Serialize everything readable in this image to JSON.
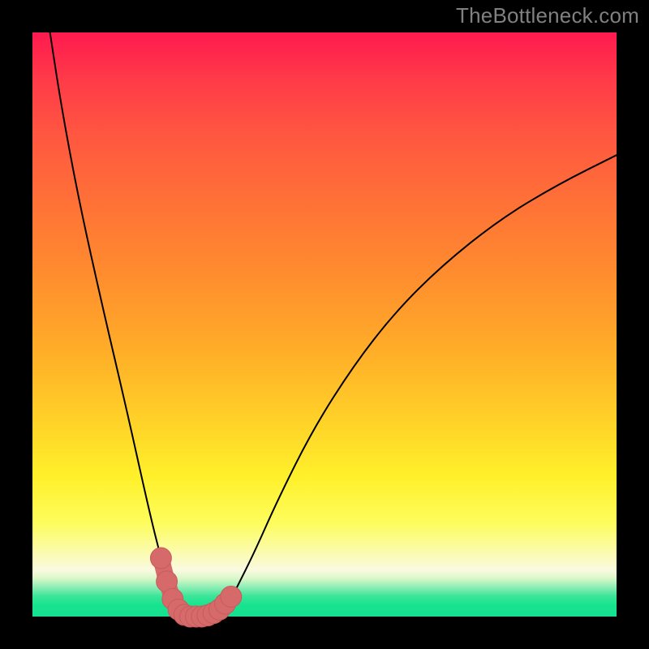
{
  "watermark": "TheBottleneck.com",
  "chart_data": {
    "type": "line",
    "title": "",
    "xlabel": "",
    "ylabel": "",
    "xlim": [
      0,
      100
    ],
    "ylim": [
      0,
      100
    ],
    "series": [
      {
        "name": "curve",
        "x": [
          3,
          5,
          8,
          12,
          16,
          20,
          22,
          24,
          25,
          26,
          27,
          28,
          30,
          32,
          33,
          34,
          35,
          38,
          42,
          48,
          55,
          62,
          70,
          80,
          90,
          100
        ],
        "values": [
          100,
          87,
          71,
          53,
          36,
          18,
          10,
          3,
          1,
          0,
          0,
          0,
          0,
          1,
          2,
          3,
          5,
          11,
          20,
          32,
          43,
          52,
          60,
          68,
          74,
          79
        ]
      }
    ],
    "markers": {
      "name": "valley-highlight",
      "color": "#d66a6a",
      "radius_frac": 0.018,
      "points_x": [
        22,
        23,
        24,
        25,
        26,
        27,
        28,
        29,
        30,
        31,
        32,
        33,
        34
      ],
      "points_y": [
        10,
        6,
        3,
        1.2,
        0.3,
        0,
        0,
        0,
        0.2,
        0.6,
        1.2,
        2.2,
        3.4
      ]
    }
  },
  "colors": {
    "curve_stroke": "#000000",
    "marker_fill": "#d66a6a",
    "marker_stroke": "#c85a5a",
    "frame_bg": "#000000",
    "watermark_color": "#808080"
  }
}
